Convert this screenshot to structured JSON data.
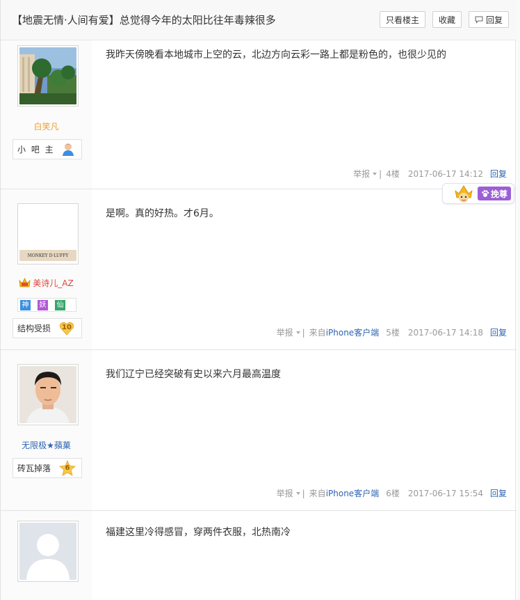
{
  "thread": {
    "title": "【地震无情·人间有爱】总觉得今年的太阳比往年毒辣很多",
    "buttons": {
      "only_op": "只看楼主",
      "favorite": "收藏",
      "reply": "回复"
    }
  },
  "posts": [
    {
      "username": "白笑凡",
      "badge_label": "小 吧 主",
      "content": "我昨天傍晚看本地城市上空的云，北边方向云彩一路上都是粉色的，也很少见的",
      "report": "举报",
      "source": "",
      "floor": "4楼",
      "time": "2017-06-17 14:12",
      "reply": "回复"
    },
    {
      "username": "美诗儿_AZ",
      "avatar_caption": "MONKEY D·LUFFY",
      "tags": [
        "神",
        "妖",
        "仙"
      ],
      "badge_label": "结构受损",
      "level": "10",
      "content": "是啊。真的好热。才6月。",
      "report": "举报",
      "source_prefix": "来自",
      "source_link": "iPhone客户端",
      "floor": "5楼",
      "time": "2017-06-17 14:18",
      "reply": "回复",
      "reward_label": "挽尊"
    },
    {
      "username": "无限极★蘋菓",
      "badge_label": "砖瓦掉落",
      "level": "6",
      "content": "我们辽宁已经突破有史以来六月最高温度",
      "report": "举报",
      "source_prefix": "来自",
      "source_link": "iPhone客户端",
      "floor": "6楼",
      "time": "2017-06-17 15:54",
      "reply": "回复"
    },
    {
      "content": "福建这里冷得感冒，穿两件衣服，北热南冷"
    }
  ],
  "colors": {
    "link_blue": "#2d64b3",
    "owner_name": "#e8a13a",
    "vip_name": "#e0453a",
    "reward_purple": "#9c5fd6"
  }
}
